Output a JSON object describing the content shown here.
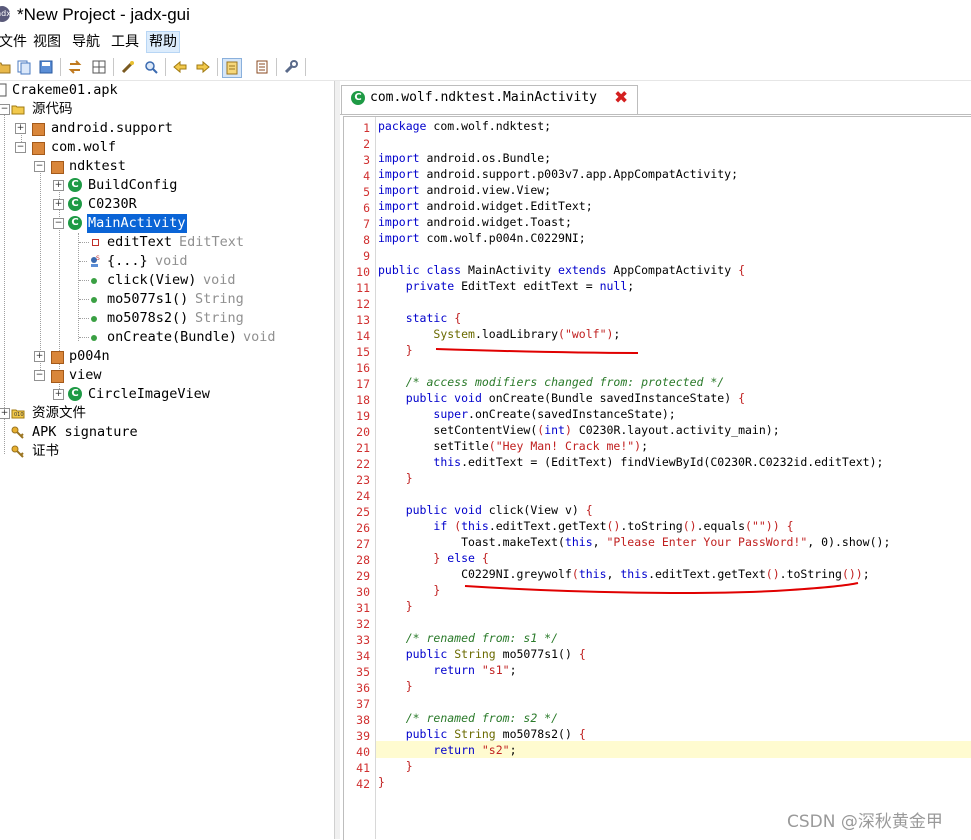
{
  "window": {
    "title": "*New Project - jadx-gui",
    "logo_text": "jadx"
  },
  "menu": [
    {
      "label": "文件",
      "active": false
    },
    {
      "label": "视图",
      "active": false
    },
    {
      "label": "导航",
      "active": false
    },
    {
      "label": "工具",
      "active": false
    },
    {
      "label": "帮助",
      "active": true
    }
  ],
  "toolbar": {
    "icons": [
      "open-file-icon",
      "add-files-icon",
      "save-all-icon",
      "sync-icon",
      "flatten-packages-icon",
      "decompile-all-icon",
      "search-icon",
      "back-icon",
      "forward-icon",
      "deobfuscation-icon",
      "log-icon",
      "preferences-icon"
    ]
  },
  "tree": {
    "apk": "Crakeme01.apk",
    "source": "源代码",
    "android_support": "android.support",
    "com_wolf": "com.wolf",
    "ndktest": "ndktest",
    "buildconfig": "BuildConfig",
    "c0230r": "C0230R",
    "mainactivity": "MainActivity",
    "members": [
      {
        "name": "editText",
        "type": "EditText",
        "kind": "field"
      },
      {
        "name": "{...}",
        "type": "void",
        "kind": "static"
      },
      {
        "name": "click(View)",
        "type": "void",
        "kind": "method"
      },
      {
        "name": "mo5077s1()",
        "type": "String",
        "kind": "method"
      },
      {
        "name": "mo5078s2()",
        "type": "String",
        "kind": "method"
      },
      {
        "name": "onCreate(Bundle)",
        "type": "void",
        "kind": "method"
      }
    ],
    "p004n": "p004n",
    "view": "view",
    "circleimageview": "CircleImageView",
    "resources": "资源文件",
    "apk_signature": "APK signature",
    "certificate": "证书"
  },
  "editor": {
    "tab_label": "com.wolf.ndktest.MainActivity",
    "highlighted_line": 40,
    "line_count": 42
  },
  "watermark": "CSDN @深秋黄金甲"
}
